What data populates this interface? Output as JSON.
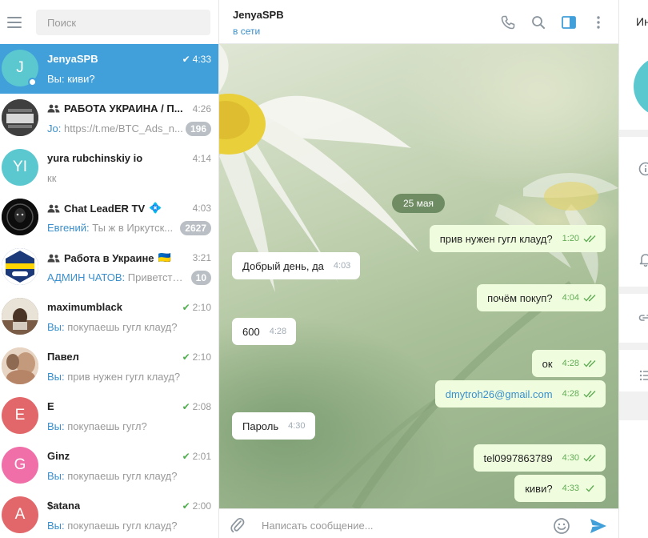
{
  "sidebar": {
    "search_placeholder": "Поиск",
    "chats": [
      {
        "name": "JenyaSPB",
        "time": "4:33",
        "preview": "Вы: киви?",
        "avatar_text": "J",
        "avatar_color": "#5bc8d0",
        "active": true,
        "online": true,
        "sent": true
      },
      {
        "name": "РАБОТА УКРАИНА / П...",
        "time": "4:26",
        "sender": "Jo:",
        "preview": "https://t.me/BTC_Ads_n...",
        "badge": "196",
        "group": true,
        "avatar_color": "#3a3a3a"
      },
      {
        "name": "yura rubchinskiy io",
        "time": "4:14",
        "preview": "кк",
        "avatar_text": "YI",
        "avatar_color": "#5bc8d0"
      },
      {
        "name": "Chat LeadER TV",
        "emoji": "💠",
        "time": "4:03",
        "sender": "Евгений:",
        "preview": "Ты ж в Иркутск...",
        "badge": "2627",
        "group": true,
        "avatar_color": "#111111"
      },
      {
        "name": "Работа в Украине",
        "emoji": "🇺🇦",
        "time": "3:21",
        "sender": "АДМИН ЧАТОВ:",
        "preview": "Приветств...",
        "badge": "10",
        "group": true,
        "avatar_color": "#1c3a7a"
      },
      {
        "name": "maximumblack",
        "time": "2:10",
        "sender": "Вы:",
        "preview": "покупаешь гугл клауд?",
        "sent": true,
        "avatar_color": "#6b5040"
      },
      {
        "name": "Павел",
        "time": "2:10",
        "sender": "Вы:",
        "preview": "прив нужен гугл клауд?",
        "sent": true,
        "avatar_color": "#c9a58c"
      },
      {
        "name": "E",
        "time": "2:08",
        "sender": "Вы:",
        "preview": "покупаешь гугл?",
        "sent": true,
        "avatar_text": "E",
        "avatar_color": "#e2676a"
      },
      {
        "name": "Ginz",
        "time": "2:01",
        "sender": "Вы:",
        "preview": "покупаешь гугл клауд?",
        "sent": true,
        "avatar_text": "G",
        "avatar_color": "#f06fa9"
      },
      {
        "name": "$atana",
        "time": "2:00",
        "sender": "Вы:",
        "preview": "покупаешь гугл клауд?",
        "sent": true,
        "avatar_text": "A",
        "avatar_color": "#e2676a"
      }
    ]
  },
  "header": {
    "peer_name": "JenyaSPB",
    "peer_status": "в сети"
  },
  "conversation": {
    "date": "25 мая",
    "messages": [
      {
        "dir": "out",
        "text": "прив нужен гугл клауд?",
        "time": "1:20",
        "read": true
      },
      {
        "dir": "in",
        "text": "Добрый день, да",
        "time": "4:03"
      },
      {
        "dir": "out",
        "text": "почём покуп?",
        "time": "4:04",
        "read": true
      },
      {
        "dir": "in",
        "text": "600",
        "time": "4:28"
      },
      {
        "dir": "out",
        "text": "ок",
        "time": "4:28",
        "read": true
      },
      {
        "dir": "out",
        "text": "dmytroh26@gmail.com",
        "time": "4:28",
        "read": true,
        "link": true
      },
      {
        "dir": "in",
        "text": "Пароль",
        "time": "4:30"
      },
      {
        "dir": "out",
        "text": "tel0997863789",
        "time": "4:30",
        "read": true
      },
      {
        "dir": "out",
        "text": "киви?",
        "time": "4:33",
        "read": false
      }
    ]
  },
  "composer": {
    "placeholder": "Написать сообщение..."
  },
  "info_panel": {
    "title": "Ин"
  },
  "colors": {
    "accent": "#419fd9",
    "outgoing_bubble": "#effdde",
    "check_green": "#4fae4e",
    "link": "#3a8fcc"
  }
}
